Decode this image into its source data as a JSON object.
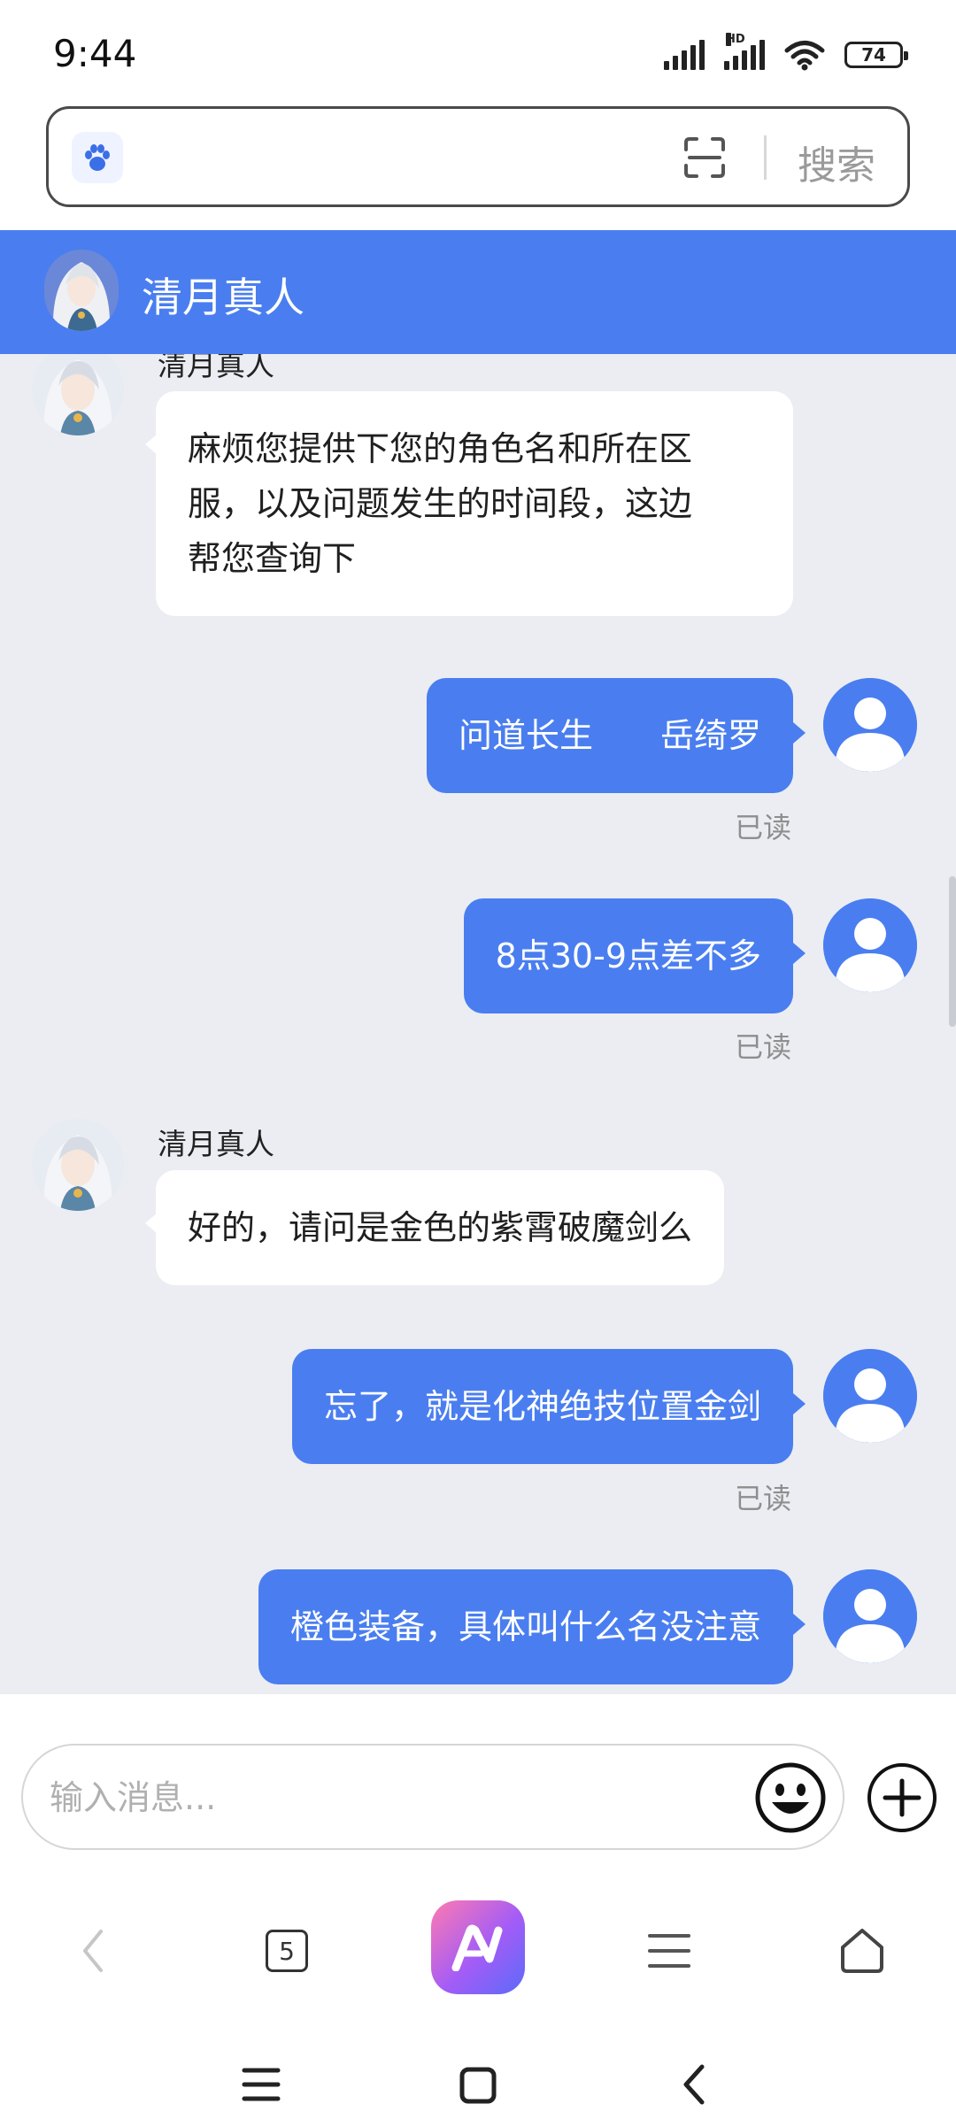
{
  "status_bar": {
    "time": "9:44",
    "network_tag": "HD",
    "battery": "74"
  },
  "search": {
    "placeholder": "",
    "search_label": "搜索",
    "icons": [
      "paw-icon",
      "scan-icon"
    ]
  },
  "chat": {
    "title": "清月真人",
    "messages": [
      {
        "side": "left",
        "sender": "清月真人",
        "lines": [
          "麻烦您提供下您的角色名和所在区",
          "服，以及问题发生的时间段，这边",
          "帮您查询下"
        ]
      },
      {
        "side": "right",
        "text": "问道长生　　岳绮罗",
        "status": "已读"
      },
      {
        "side": "right",
        "text": "8点30-9点差不多",
        "status": "已读"
      },
      {
        "side": "left",
        "sender": "清月真人",
        "text": "好的，请问是金色的紫霄破魔剑么"
      },
      {
        "side": "right",
        "text": "忘了，就是化神绝技位置金剑",
        "status": "已读"
      },
      {
        "side": "right",
        "text": "橙色装备，具体叫什么名没注意"
      }
    ]
  },
  "composer": {
    "placeholder": "输入消息...",
    "icons": [
      "emoji-icon",
      "plus-icon"
    ]
  },
  "browser_toolbar": {
    "tabs_count": "5",
    "icons": [
      "back-icon",
      "tabs-icon",
      "app-logo-icon",
      "menu-icon",
      "home-icon"
    ]
  },
  "system_nav": {
    "icons": [
      "recent-apps-icon",
      "home-square-icon",
      "back-chevron-icon"
    ]
  },
  "colors": {
    "accent": "#4a7ef0",
    "chat_background": "#ebedf2",
    "bubble_left": "#ffffff",
    "read_text": "#8e8e8e"
  }
}
